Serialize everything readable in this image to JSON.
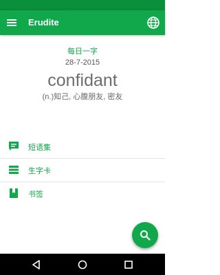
{
  "app": {
    "title": "Erudite"
  },
  "icons": {
    "menu": "hamburger-menu-icon",
    "language": "globe-icon",
    "search": "search-icon",
    "phrasebook": "chat-bubble-icon",
    "flashcards": "list-card-icon",
    "bookmarks": "bookmark-icon",
    "nav_back": "triangle-back-icon",
    "nav_home": "circle-home-icon",
    "nav_recent": "square-recent-icon"
  },
  "word_of_day": {
    "heading": "每日一字",
    "date": "28-7-2015",
    "word": "confidant",
    "definition": "(n.)知己, 心腹朋友, 密友"
  },
  "menu": [
    {
      "label": "短语集"
    },
    {
      "label": "生字卡"
    },
    {
      "label": "书签"
    }
  ],
  "colors": {
    "primary": "#10a84a",
    "status_bar": "#0a8f3b",
    "nav_bar": "#000000"
  }
}
